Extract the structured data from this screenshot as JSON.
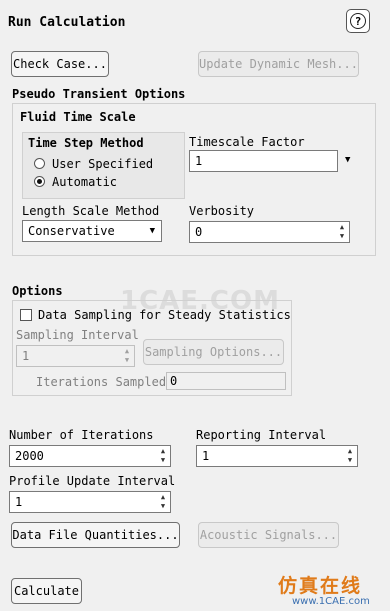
{
  "header": {
    "title": "Run Calculation",
    "help_glyph": "?"
  },
  "buttons": {
    "check_case": "Check Case...",
    "update_dynamic_mesh": "Update Dynamic Mesh...",
    "sampling_options": "Sampling Options...",
    "data_file_quantities": "Data File Quantities...",
    "acoustic_signals": "Acoustic Signals...",
    "calculate": "Calculate"
  },
  "pseudo_transient": {
    "title": "Pseudo Transient Options",
    "fluid_time_scale": {
      "title": "Fluid Time Scale",
      "time_step_method": {
        "label": "Time Step Method",
        "options": [
          "User Specified",
          "Automatic"
        ],
        "selected": "Automatic"
      },
      "timescale_factor": {
        "label": "Timescale Factor",
        "value": "1"
      },
      "length_scale_method": {
        "label": "Length Scale Method",
        "value": "Conservative"
      },
      "verbosity": {
        "label": "Verbosity",
        "value": "0"
      }
    }
  },
  "options": {
    "title": "Options",
    "data_sampling": {
      "label": "Data Sampling for Steady Statistics",
      "checked": false
    },
    "sampling_interval": {
      "label": "Sampling Interval",
      "value": "1"
    },
    "iterations_sampled": {
      "label": "Iterations Sampled",
      "value": "0"
    }
  },
  "run": {
    "number_of_iterations": {
      "label": "Number of Iterations",
      "value": "2000"
    },
    "reporting_interval": {
      "label": "Reporting Interval",
      "value": "1"
    },
    "profile_update_interval": {
      "label": "Profile Update Interval",
      "value": "1"
    }
  },
  "watermarks": {
    "center": "1CAE.COM",
    "corner_cn": "仿真在线",
    "corner_url": "www.1CAE.com"
  },
  "colors": {
    "watermark_orange": "#e07b1a",
    "watermark_gray": "#c8c8c8",
    "disabled_text": "#a0a0a0"
  }
}
